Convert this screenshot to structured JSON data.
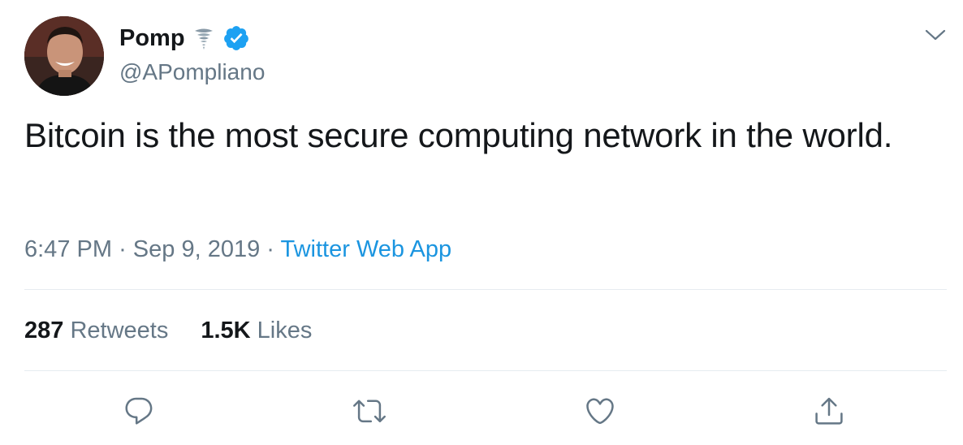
{
  "author": {
    "display_name": "Pomp",
    "handle": "@APompliano",
    "name_emoji": "tornado-emoji",
    "verified": true
  },
  "tweet": {
    "text": "Bitcoin is the most secure computing network in the world.",
    "time": "6:47 PM",
    "date": "Sep 9, 2019",
    "source": "Twitter Web App"
  },
  "stats": {
    "retweets_count": "287",
    "retweets_label": "Retweets",
    "likes_count": "1.5K",
    "likes_label": "Likes"
  },
  "actions": {
    "reply_icon": "reply-icon",
    "retweet_icon": "retweet-icon",
    "like_icon": "heart-icon",
    "share_icon": "share-icon"
  },
  "colors": {
    "link": "#1b95e0",
    "secondary_text": "#657786",
    "verified_badge": "#1da1f2",
    "divider": "#e6ecf0"
  },
  "separator": "·"
}
